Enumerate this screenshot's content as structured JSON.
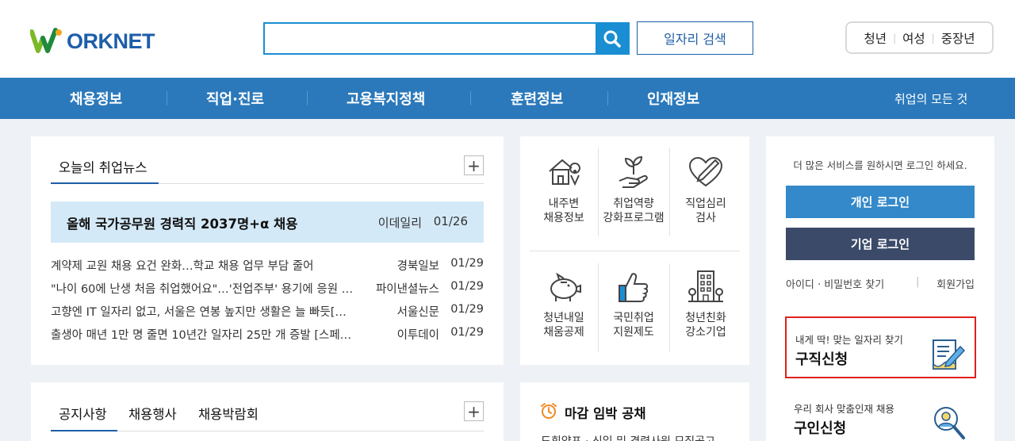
{
  "header": {
    "logo_text": "ORKNET",
    "search_placeholder": "",
    "job_search_label": "일자리 검색",
    "quick_links": [
      "청년",
      "여성",
      "중장년"
    ]
  },
  "nav": {
    "items": [
      "채용정보",
      "직업·진로",
      "고용복지정책",
      "훈련정보",
      "인재정보"
    ],
    "all_label": "취업의 모든 것"
  },
  "news": {
    "tab_label": "오늘의 취업뉴스",
    "headline": {
      "title": "올해 국가공무원 경력직 2037명+α 채용",
      "source": "이데일리",
      "date": "01/26"
    },
    "items": [
      {
        "title": "계약제 교원 채용 요건 완화…학교 채용 업무 부담 줄어",
        "source": "경북일보",
        "date": "01/29"
      },
      {
        "title": "\"나이 60에 난생 처음 취업했어요\"…'전업주부' 용기에 응원 …",
        "source": "파이낸셜뉴스",
        "date": "01/29"
      },
      {
        "title": "고향엔 IT 일자리 없고, 서울은 연봉 높지만 생활은 늘 빠듯[…",
        "source": "서울신문",
        "date": "01/29"
      },
      {
        "title": "출생아 매년 1만 명 줄면 10년간 일자리 25만 개 증발 [스페…",
        "source": "이투데이",
        "date": "01/29"
      }
    ]
  },
  "notice": {
    "tabs": [
      "공지사항",
      "채용행사",
      "채용박람회"
    ]
  },
  "services": [
    {
      "line1": "내주변",
      "line2": "채용정보",
      "icon": "house-location-icon"
    },
    {
      "line1": "취업역량",
      "line2": "강화프로그램",
      "icon": "sprout-hand-icon"
    },
    {
      "line1": "직업심리",
      "line2": "검사",
      "icon": "heart-pen-icon"
    },
    {
      "line1": "청년내일",
      "line2": "채움공제",
      "icon": "piggy-bank-icon"
    },
    {
      "line1": "국민취업",
      "line2": "지원제도",
      "icon": "thumbs-up-icon"
    },
    {
      "line1": "청년친화",
      "line2": "강소기업",
      "icon": "building-icon"
    }
  ],
  "deadline": {
    "title": "마감 임박 공채",
    "sub": "도휘양포 · 신입 및 경력사원 모집공고"
  },
  "login": {
    "message": "더 많은 서비스를 원하시면 로그인 하세요.",
    "personal_label": "개인 로그인",
    "company_label": "기업 로그인",
    "find_label": "아이디 · 비밀번호 찾기",
    "join_label": "회원가입",
    "card1": {
      "sub": "내게 딱! 맞는 일자리 찾기",
      "title": "구직신청"
    },
    "card2": {
      "sub": "우리 회사 맞춤인재 채용",
      "title": "구인신청"
    }
  },
  "colors": {
    "nav_bg": "#2b79bb",
    "search_border": "#1a8ed2",
    "personal_login_bg": "#3389c9",
    "company_login_bg": "#3b4a69",
    "highlight_border": "#e0201d",
    "headline_bg": "#d4e9f7"
  }
}
